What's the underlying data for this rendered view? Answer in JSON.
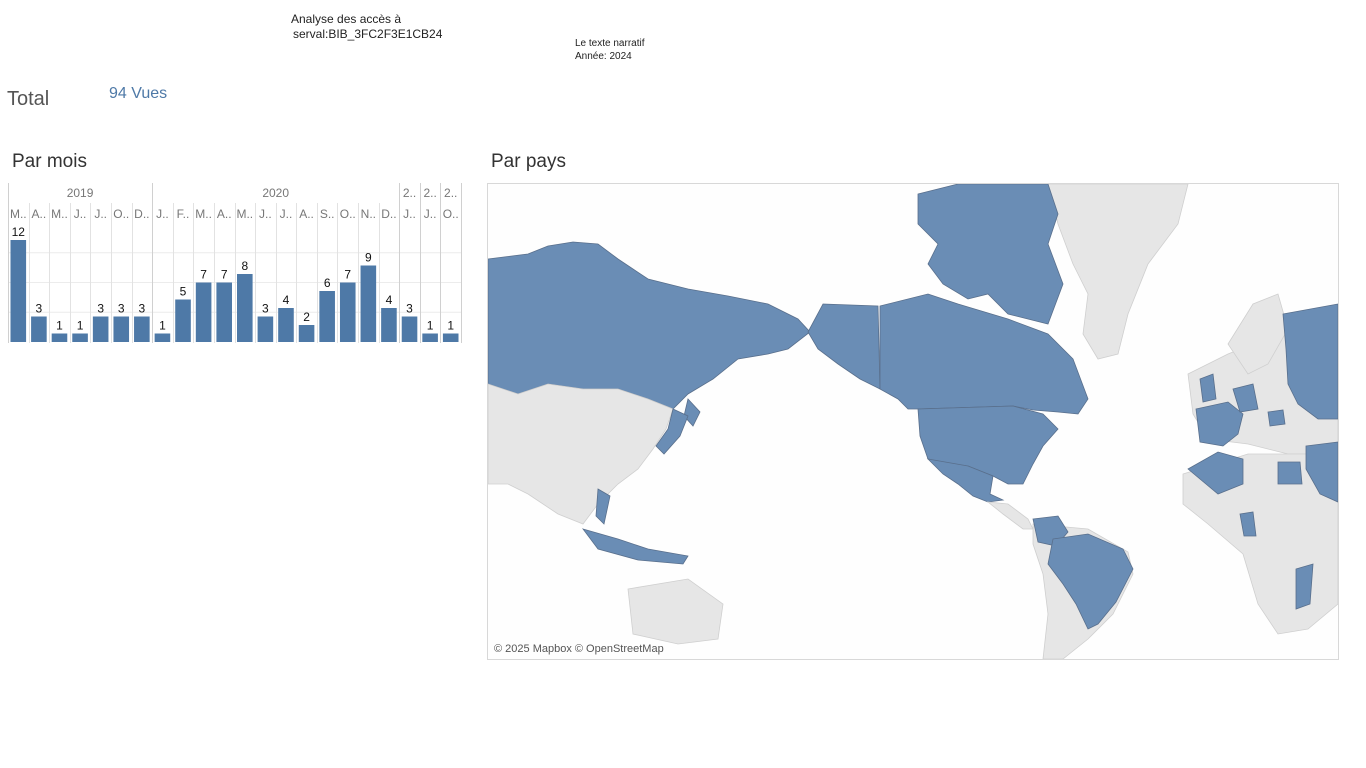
{
  "header": {
    "title_line1": "Analyse des accès à",
    "title_line2": "serval:BIB_3FC2F3E1CB24",
    "narrative_line1": "Le texte narratif",
    "narrative_line2": "Année: 2024"
  },
  "summary": {
    "total_label": "Total",
    "total_value": "94 Vues"
  },
  "sections": {
    "by_month": "Par mois",
    "by_country": "Par pays"
  },
  "chart_data": {
    "type": "bar",
    "year_groups": [
      {
        "label": "2019",
        "count": 7
      },
      {
        "label": "2020",
        "count": 12
      },
      {
        "label": "2..",
        "count": 1
      },
      {
        "label": "2..",
        "count": 1
      },
      {
        "label": "2..",
        "count": 1
      }
    ],
    "categories": [
      "M..",
      "A..",
      "M..",
      "J..",
      "J..",
      "O..",
      "D..",
      "J..",
      "F..",
      "M..",
      "A..",
      "M..",
      "J..",
      "J..",
      "A..",
      "S..",
      "O..",
      "N..",
      "D..",
      "J..",
      "J..",
      "O.."
    ],
    "values": [
      12,
      3,
      1,
      1,
      3,
      3,
      3,
      1,
      5,
      7,
      7,
      8,
      3,
      4,
      2,
      6,
      7,
      9,
      4,
      3,
      1,
      1
    ],
    "ylim": [
      0,
      14
    ],
    "grid": true,
    "color": "#4e79a7"
  },
  "map": {
    "attribution": "© 2025 Mapbox © OpenStreetMap",
    "highlight_color": "#6a8db5",
    "base_color": "#e6e6e6"
  }
}
